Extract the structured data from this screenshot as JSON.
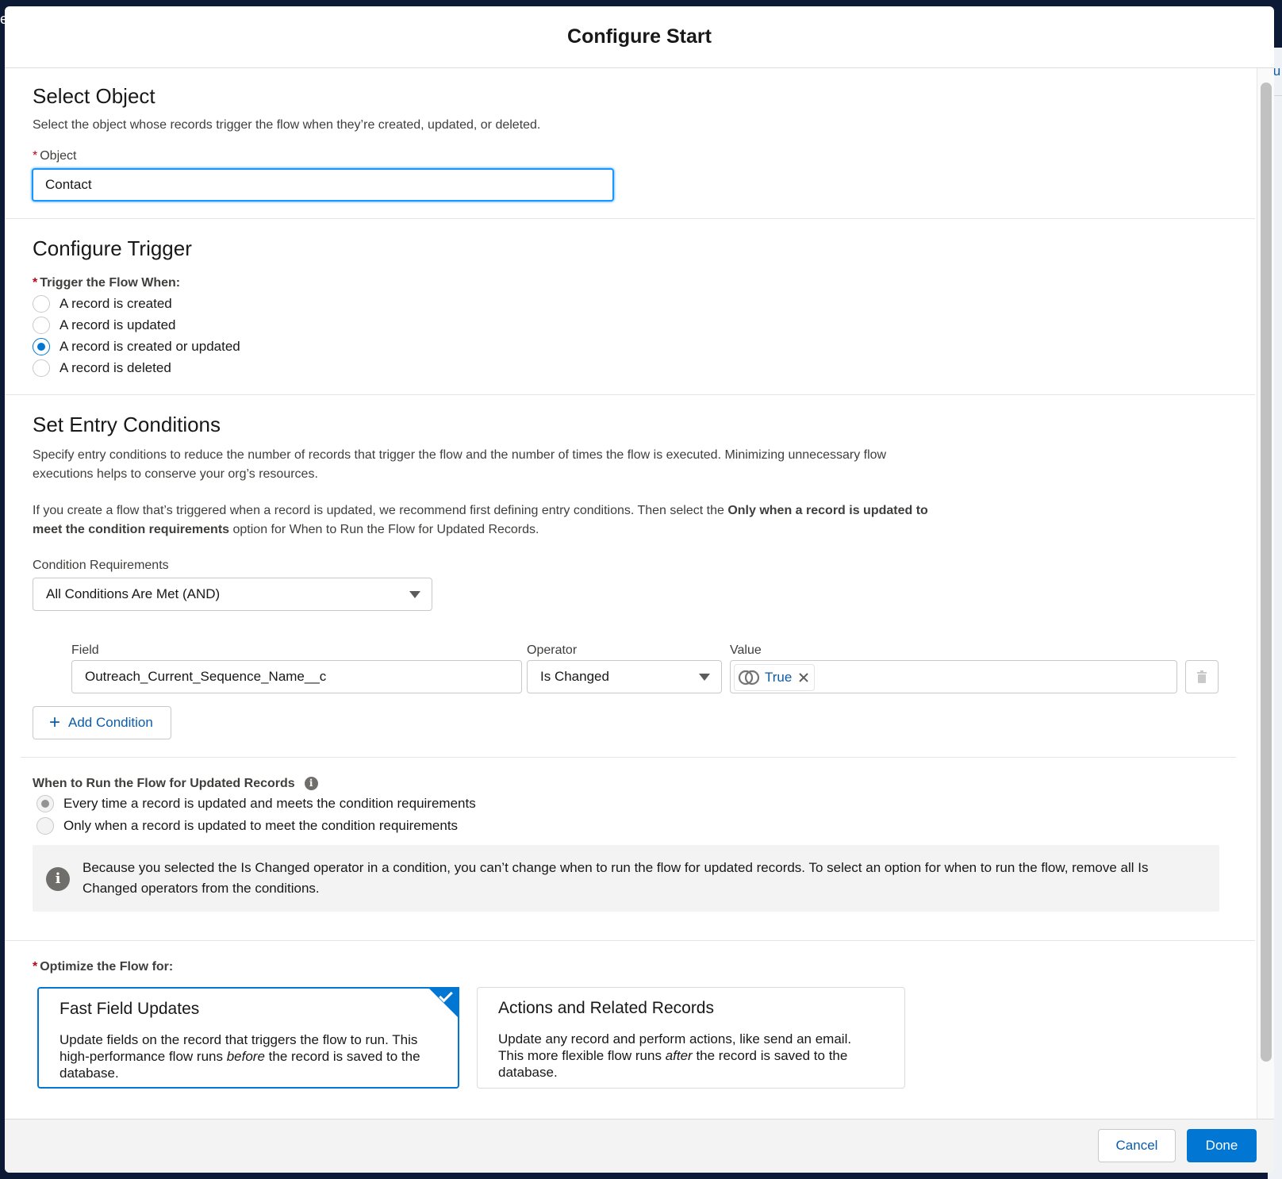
{
  "background": {
    "right_edge_text": "tu",
    "left_edge_text": "e"
  },
  "modal": {
    "title": "Configure Start"
  },
  "select_object": {
    "heading": "Select Object",
    "description": "Select the object whose records trigger the flow when they’re created, updated, or deleted.",
    "required_mark": "*",
    "object_label": "Object",
    "object_value": "Contact"
  },
  "configure_trigger": {
    "heading": "Configure Trigger",
    "required_mark": "*",
    "trigger_label": "Trigger the Flow When:",
    "options": [
      {
        "label": "A record is created",
        "checked": false
      },
      {
        "label": "A record is updated",
        "checked": false
      },
      {
        "label": "A record is created or updated",
        "checked": true
      },
      {
        "label": "A record is deleted",
        "checked": false
      }
    ]
  },
  "entry_conditions": {
    "heading": "Set Entry Conditions",
    "description_1": "Specify entry conditions to reduce the number of records that trigger the flow and the number of times the flow is executed. Minimizing unnecessary flow executions helps to conserve your org’s resources.",
    "description_2_prefix": "If you create a flow that’s triggered when a record is updated, we recommend first defining entry conditions. Then select the ",
    "description_2_bold": "Only when a record is updated to meet the condition requirements",
    "description_2_suffix": " option for When to Run the Flow for Updated Records.",
    "condition_requirements_label": "Condition Requirements",
    "condition_requirements_value": "All Conditions Are Met (AND)",
    "field_label": "Field",
    "field_value": "Outreach_Current_Sequence_Name__c",
    "operator_label": "Operator",
    "operator_value": "Is Changed",
    "value_label": "Value",
    "value_pill": "True",
    "add_condition_label": "Add Condition"
  },
  "when_to_run": {
    "label": "When to Run the Flow for Updated Records",
    "info_glyph": "i",
    "options": [
      {
        "label": "Every time a record is updated and meets the condition requirements",
        "checked": true
      },
      {
        "label": "Only when a record is updated to meet the condition requirements",
        "checked": false
      }
    ],
    "info_text": "Because you selected the Is Changed operator in a condition, you can’t change when to run the flow for updated records. To select an option for when to run the flow, remove all Is Changed operators from the conditions."
  },
  "optimize": {
    "required_mark": "*",
    "label": "Optimize the Flow for:",
    "cards": [
      {
        "title": "Fast Field Updates",
        "desc_prefix": "Update fields on the record that triggers the flow to run. This high-performance flow runs ",
        "desc_em": "before",
        "desc_suffix": " the record is saved to the database.",
        "selected": true
      },
      {
        "title": "Actions and Related Records",
        "desc_prefix": "Update any record and perform actions, like send an email. This more flexible flow runs ",
        "desc_em": "after",
        "desc_suffix": " the record is saved to the database.",
        "selected": false
      }
    ]
  },
  "footer": {
    "cancel_label": "Cancel",
    "done_label": "Done"
  },
  "colors": {
    "brand": "#0176d3",
    "link": "#0b5cab",
    "required": "#ba0517",
    "focus": "#1b96ff"
  }
}
